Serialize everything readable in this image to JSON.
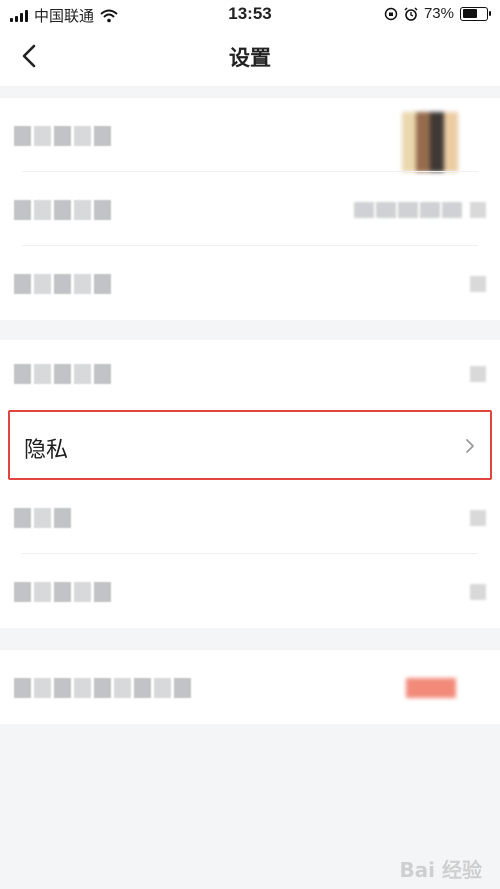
{
  "status_bar": {
    "carrier": "中国联通",
    "time": "13:53",
    "battery": "73%",
    "battery_level": 0.73
  },
  "header": {
    "title": "设置",
    "back_icon": "chevron-left-icon"
  },
  "groups": [
    {
      "rows": [
        "blurred-profile-row",
        "blurred-account-row",
        "blurred-security-row"
      ]
    },
    {
      "rows": [
        "blurred-notification-row",
        "privacy-row",
        "blurred-general-row",
        "blurred-storage-row"
      ]
    },
    {
      "rows": [
        "blurred-about-row"
      ]
    }
  ],
  "privacy": {
    "label": "隐私"
  },
  "watermark": {
    "text": "Bai 经验"
  },
  "colors": {
    "highlight_border": "#e0453f",
    "background": "#f4f5f7"
  }
}
